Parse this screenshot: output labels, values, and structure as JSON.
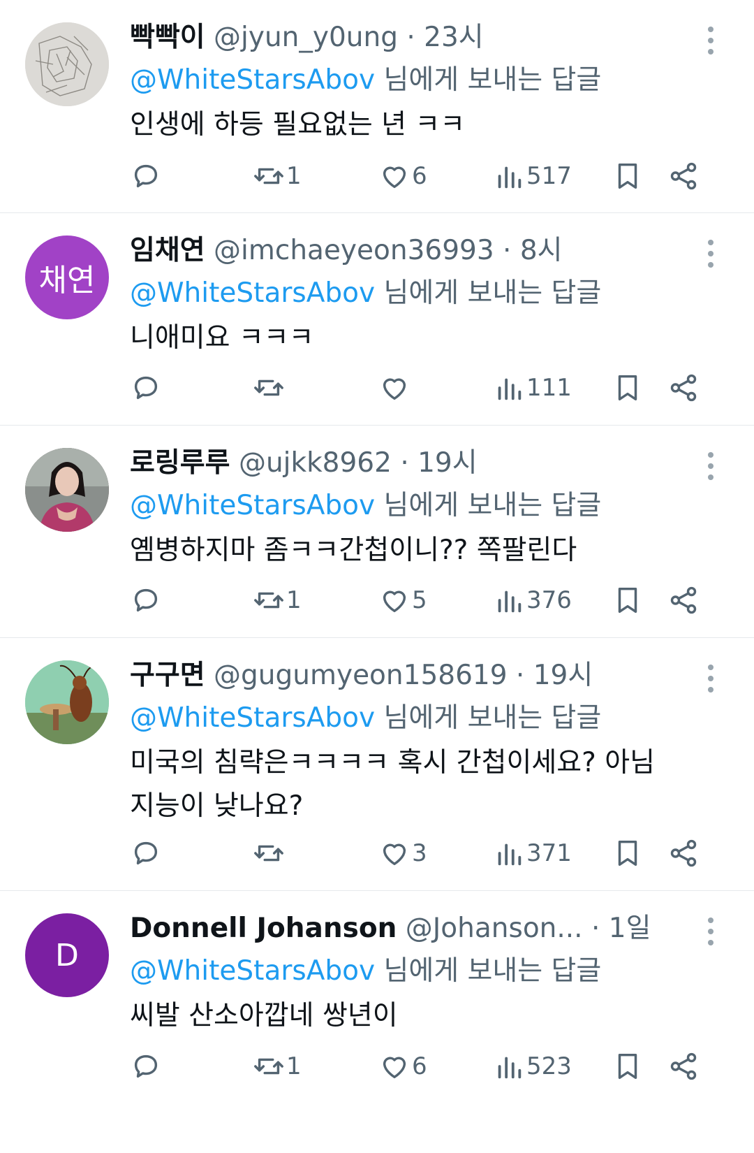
{
  "tweets": [
    {
      "display_name": "빡빡이",
      "handle": "@jyun_y0ung",
      "time": " · 23시",
      "reply_mention": "@WhiteStarsAbov",
      "reply_suffix": " 님에게 보내는 답글",
      "text": "인생에 하등 필요없는 년 ㅋㅋ",
      "avatar": {
        "type": "image",
        "icon": "sketch-drawing-avatar"
      },
      "retweets": "1",
      "likes": "6",
      "views": "517"
    },
    {
      "display_name": "임채연",
      "handle": "@imchaeyeon36993",
      "time": " · 8시",
      "reply_mention": "@WhiteStarsAbov",
      "reply_suffix": " 님에게 보내는 답글",
      "text": "니애미요 ㅋㅋㅋ",
      "avatar": {
        "type": "text",
        "label": "채연",
        "color": "#a142c6"
      },
      "retweets": "",
      "likes": "",
      "views": "111"
    },
    {
      "display_name": "로링루루",
      "handle": "@ujkk8962",
      "time": " · 19시",
      "reply_mention": "@WhiteStarsAbov",
      "reply_suffix": " 님에게 보내는 답글",
      "text": "옘병하지마 좀ㅋㅋ간첩이니?? 쪽팔린다",
      "avatar": {
        "type": "image",
        "icon": "portrait-photo-avatar"
      },
      "retweets": "1",
      "likes": "5",
      "views": "376"
    },
    {
      "display_name": "구구면",
      "handle": "@gugumyeon158619",
      "time": " · 19시",
      "reply_mention": "@WhiteStarsAbov",
      "reply_suffix": " 님에게 보내는 답글",
      "text": "미국의 침략은ㅋㅋㅋㅋ 혹시 간첩이세요? 아님 지능이 낮나요?",
      "avatar": {
        "type": "image",
        "icon": "cartoon-cockroach-avatar"
      },
      "retweets": "",
      "likes": "3",
      "views": "371"
    },
    {
      "display_name": "Donnell Johanson",
      "handle": "@Johanson...",
      "time": " · 1일",
      "reply_mention": "@WhiteStarsAbov",
      "reply_suffix": " 님에게 보내는 답글",
      "text": "씨발 산소아깝네 쌍년이",
      "avatar": {
        "type": "text",
        "label": "D",
        "color": "#7b1fa2"
      },
      "retweets": "1",
      "likes": "6",
      "views": "523"
    }
  ],
  "colors": {
    "mention": "#1d9bf0",
    "secondary_text": "#536471",
    "divider": "#e6e9ec"
  },
  "icons": [
    "reply-icon",
    "retweet-icon",
    "like-icon",
    "views-icon",
    "bookmark-icon",
    "share-icon",
    "more-icon"
  ]
}
